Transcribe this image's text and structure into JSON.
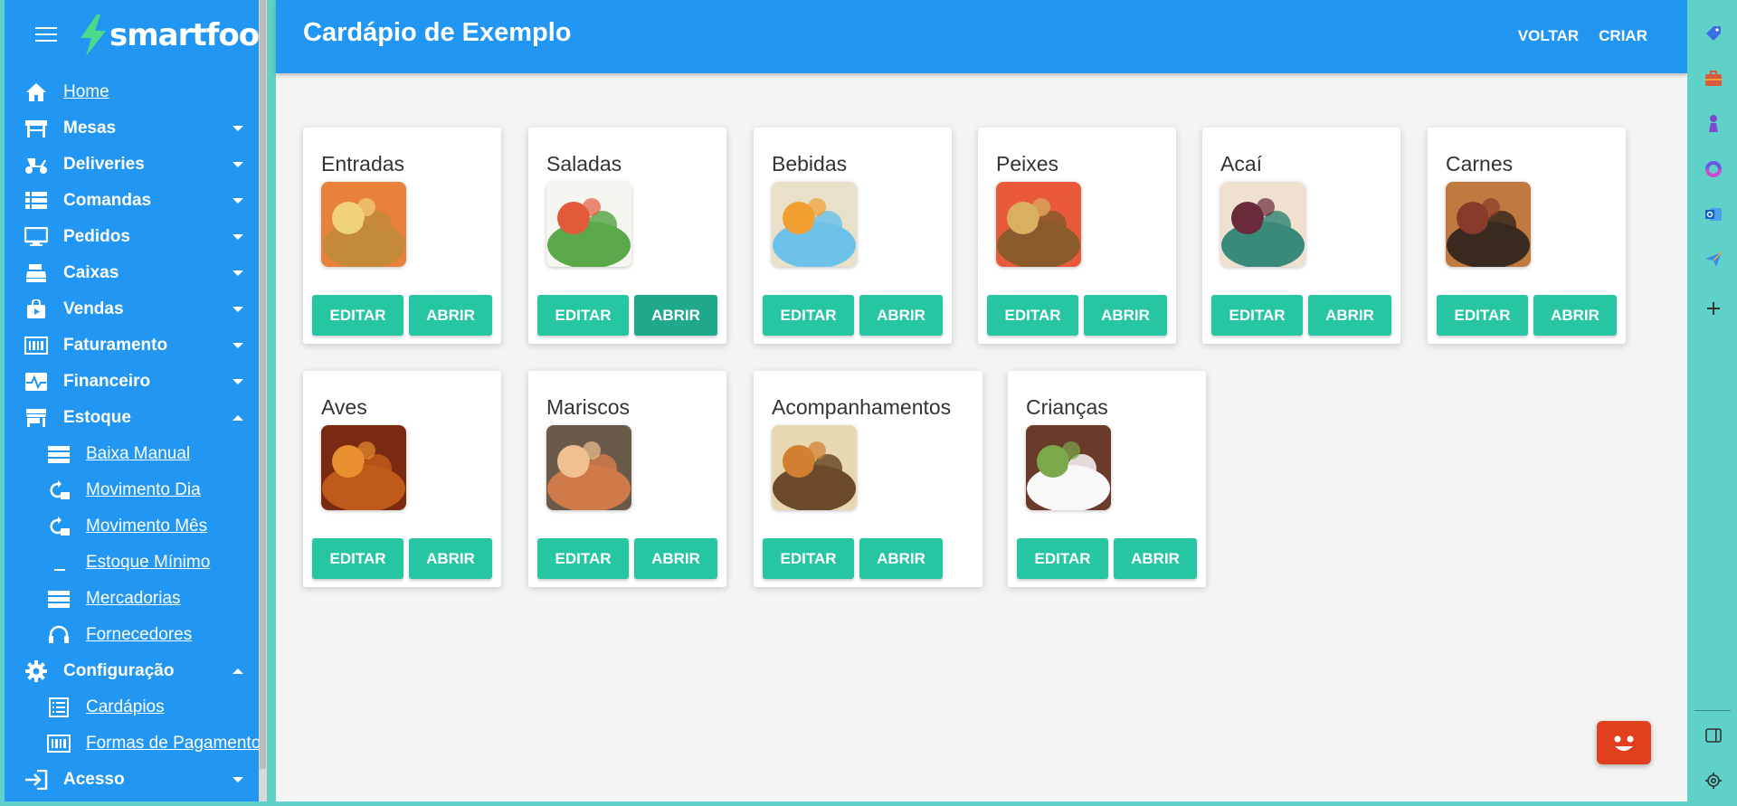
{
  "brand": {
    "name": "smartfood"
  },
  "sidebar": {
    "items": [
      {
        "label": "Home",
        "icon": "home-icon",
        "link": true,
        "caret": "none"
      },
      {
        "label": "Mesas",
        "icon": "table-icon",
        "caret": "down"
      },
      {
        "label": "Deliveries",
        "icon": "scooter-icon",
        "caret": "down"
      },
      {
        "label": "Comandas",
        "icon": "list-icon",
        "caret": "down"
      },
      {
        "label": "Pedidos",
        "icon": "monitor-icon",
        "caret": "down"
      },
      {
        "label": "Caixas",
        "icon": "cash-register-icon",
        "caret": "down"
      },
      {
        "label": "Vendas",
        "icon": "shopping-bag-icon",
        "caret": "down"
      },
      {
        "label": "Faturamento",
        "icon": "barcode-icon",
        "caret": "down"
      },
      {
        "label": "Financeiro",
        "icon": "pulse-icon",
        "caret": "down"
      },
      {
        "label": "Estoque",
        "icon": "store-icon",
        "caret": "up"
      }
    ],
    "estoque_sub": [
      {
        "label": "Baixa Manual",
        "icon": "server-icon"
      },
      {
        "label": "Movimento Dia",
        "icon": "refresh-icon"
      },
      {
        "label": "Movimento Mês",
        "icon": "refresh-icon"
      },
      {
        "label": "Estoque Mínimo",
        "icon": "underscore-icon"
      },
      {
        "label": "Mercadorias",
        "icon": "server-icon"
      },
      {
        "label": "Fornecedores",
        "icon": "headset-icon"
      }
    ],
    "config": {
      "label": "Configuração",
      "icon": "gear-icon",
      "caret": "up"
    },
    "config_sub": [
      {
        "label": "Cardápios",
        "icon": "list-icon"
      },
      {
        "label": "Formas de Pagamento",
        "icon": "barcode-icon"
      }
    ],
    "acesso": {
      "label": "Acesso",
      "icon": "login-icon",
      "caret": "down"
    }
  },
  "header": {
    "title": "Cardápio de Exemplo",
    "back_label": "VOLTAR",
    "create_label": "CRIAR"
  },
  "cards": [
    {
      "title": "Entradas",
      "edit": "EDITAR",
      "open": "ABRIR",
      "colors": [
        "#c48a3a",
        "#f0d27a",
        "#e8823a"
      ]
    },
    {
      "title": "Saladas",
      "edit": "EDITAR",
      "open": "ABRIR",
      "colors": [
        "#5aa84a",
        "#e25a3a",
        "#f6f6f0"
      ]
    },
    {
      "title": "Bebidas",
      "edit": "EDITAR",
      "open": "ABRIR",
      "colors": [
        "#6cc2e8",
        "#f0a030",
        "#e8e0c8"
      ]
    },
    {
      "title": "Peixes",
      "edit": "EDITAR",
      "open": "ABRIR",
      "colors": [
        "#8a5a2a",
        "#d8b060",
        "#e85a3a"
      ]
    },
    {
      "title": "Acaí",
      "edit": "EDITAR",
      "open": "ABRIR",
      "colors": [
        "#3a8a7a",
        "#6a2a3a",
        "#f0e0d0"
      ]
    },
    {
      "title": "Carnes",
      "edit": "EDITAR",
      "open": "ABRIR",
      "colors": [
        "#3a2a20",
        "#8a3a2a",
        "#c07a40"
      ]
    },
    {
      "title": "Aves",
      "edit": "EDITAR",
      "open": "ABRIR",
      "colors": [
        "#c05a1a",
        "#e89030",
        "#7a2a10"
      ]
    },
    {
      "title": "Mariscos",
      "edit": "EDITAR",
      "open": "ABRIR",
      "colors": [
        "#d07a4a",
        "#f0c090",
        "#6a5a4a"
      ]
    },
    {
      "title": "Acompanhamentos",
      "edit": "EDITAR",
      "open": "ABRIR",
      "colors": [
        "#6a4a2a",
        "#d08030",
        "#e8d8b0"
      ]
    },
    {
      "title": "Crianças",
      "edit": "EDITAR",
      "open": "ABRIR",
      "colors": [
        "#f8f8f8",
        "#7aa84a",
        "#6a3a2a"
      ]
    }
  ],
  "right_sidebar": {
    "icons": [
      "tag-icon",
      "briefcase-icon",
      "chess-icon",
      "copilot-icon",
      "outlook-icon",
      "send-icon",
      "plus-icon",
      "panel-icon",
      "gear-icon"
    ]
  },
  "colors": {
    "primary": "#2196f3",
    "button": "#26c6a2",
    "chatbot": "#e0401e",
    "background": "#f4f4f4"
  }
}
